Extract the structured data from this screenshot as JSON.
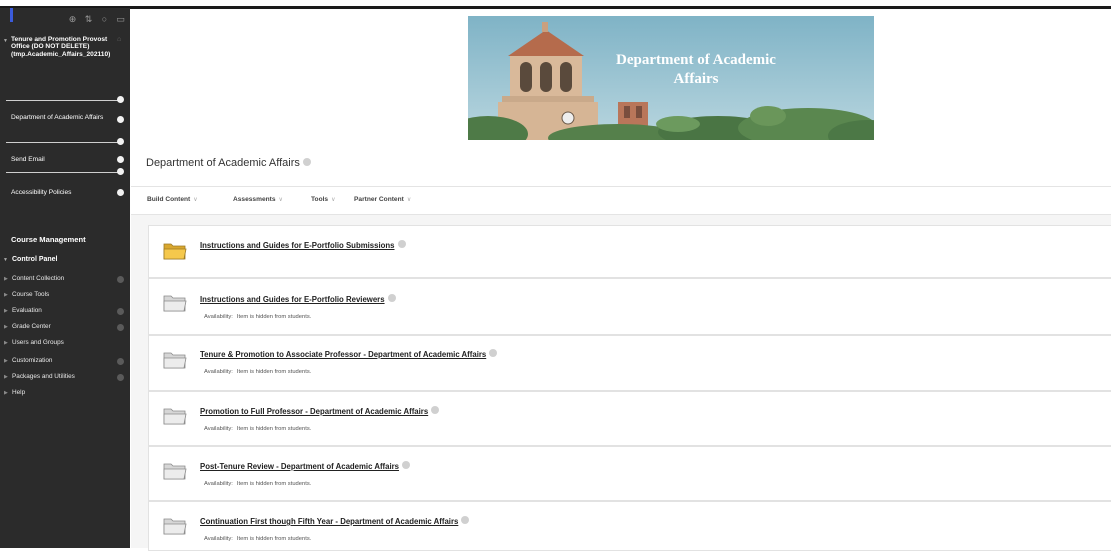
{
  "sidebar": {
    "course_title": "Tenure and Promotion Provost Office (DO NOT DELETE) (tmp.Academic_Affairs_202110)",
    "links": [
      {
        "label": "Department of Academic Affairs"
      },
      {
        "label": "Send Email"
      },
      {
        "label": "Accessibility Policies"
      }
    ],
    "course_management": "Course Management",
    "control_panel": "Control Panel",
    "tools": [
      {
        "label": "Content Collection"
      },
      {
        "label": "Course Tools"
      },
      {
        "label": "Evaluation"
      },
      {
        "label": "Grade Center"
      },
      {
        "label": "Users and Groups"
      },
      {
        "label": "Customization"
      },
      {
        "label": "Packages and Utilities"
      },
      {
        "label": "Help"
      }
    ]
  },
  "banner": {
    "line1": "Department of Academic",
    "line2": "Affairs"
  },
  "page": {
    "title": "Department of Academic Affairs"
  },
  "toolbar": {
    "build_content": "Build Content",
    "assessments": "Assessments",
    "tools": "Tools",
    "partner_content": "Partner Content"
  },
  "items": [
    {
      "title": "Instructions and Guides for E-Portfolio Submissions",
      "availability_label": "",
      "availability": ""
    },
    {
      "title": "Instructions and Guides for E-Portfolio Reviewers",
      "availability_label": "Availability:",
      "availability": "Item is hidden from students."
    },
    {
      "title": "Tenure & Promotion to Associate Professor - Department of Academic Affairs",
      "availability_label": "Availability:",
      "availability": "Item is hidden from students."
    },
    {
      "title": "Promotion to Full Professor - Department of Academic Affairs",
      "availability_label": "Availability:",
      "availability": "Item is hidden from students."
    },
    {
      "title": "Post-Tenure Review - Department of Academic Affairs",
      "availability_label": "Availability:",
      "availability": "Item is hidden from students."
    },
    {
      "title": "Continuation First though Fifth Year - Department of Academic Affairs",
      "availability_label": "Availability:",
      "availability": "Item is hidden from students."
    }
  ],
  "colors": {
    "sidebar_bg": "#2b2b2b",
    "folder_open": "#f5c84c",
    "folder_closed": "#e9e9e9"
  }
}
